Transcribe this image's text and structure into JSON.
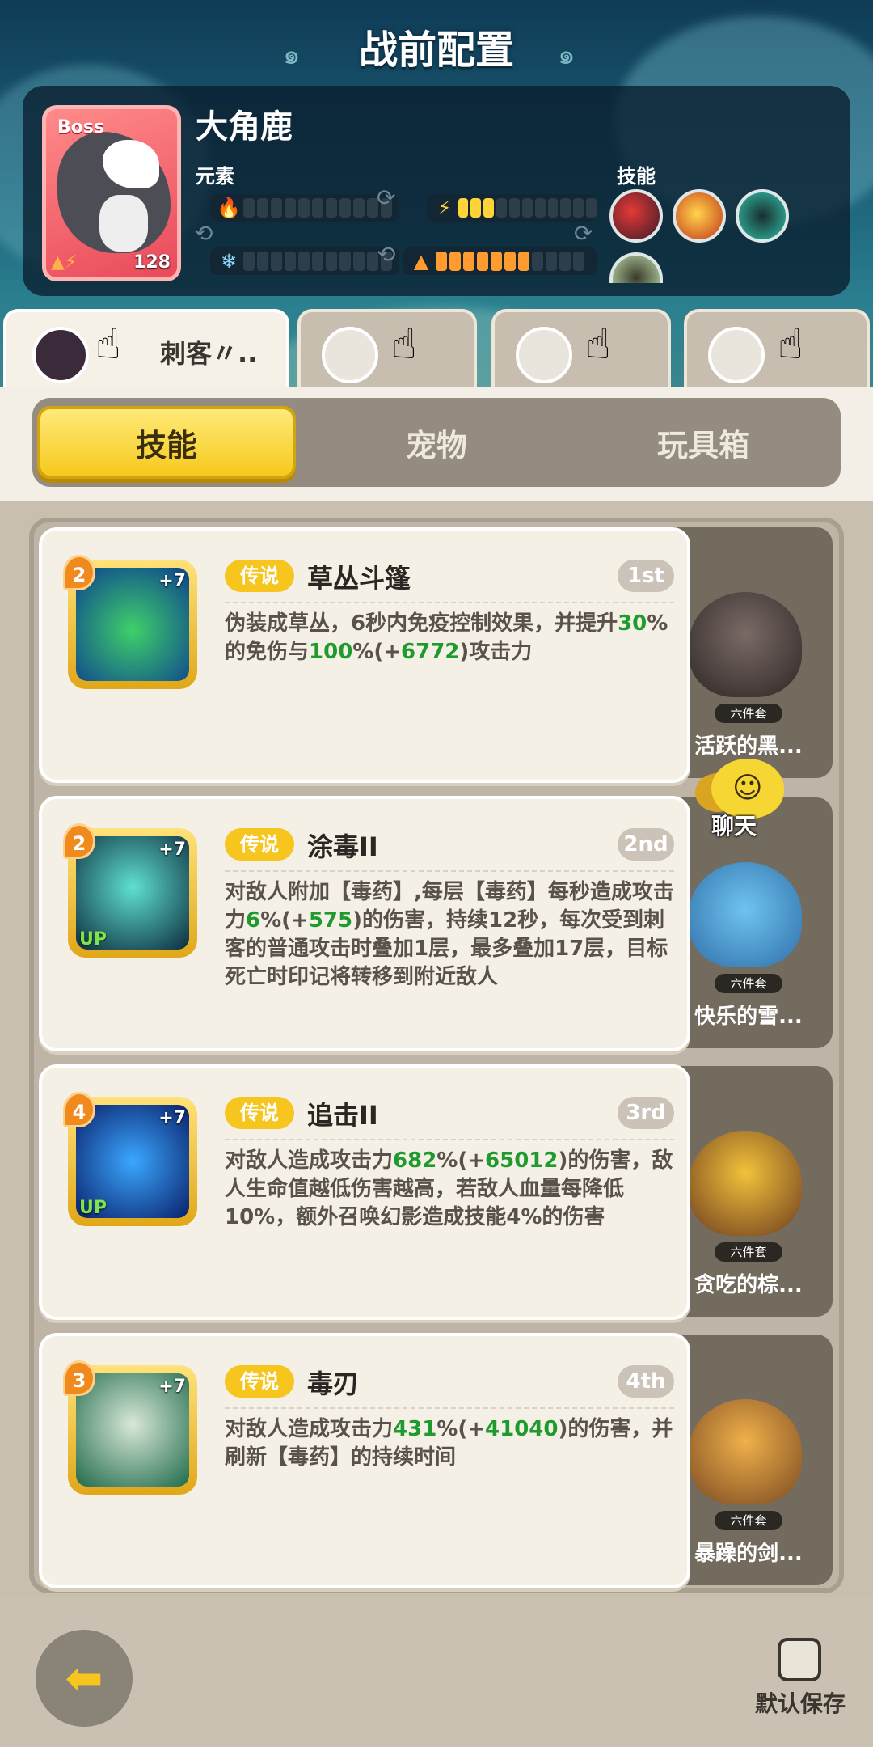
{
  "header": {
    "title": "战前配置"
  },
  "boss": {
    "tag": "Boss",
    "name": "大角鹿",
    "level": "128",
    "element_label": "元素",
    "skill_label": "技能",
    "elements": [
      {
        "icon": "fire-icon",
        "filled": 0,
        "total": 11
      },
      {
        "icon": "lightning-icon",
        "filled": 3,
        "total": 11
      },
      {
        "icon": "snowflake-icon",
        "filled": 0,
        "total": 11
      },
      {
        "icon": "earth-icon",
        "filled": 7,
        "total": 11
      }
    ],
    "colors": {
      "lightning": "#ffd43b",
      "earth": "#ff9b2f"
    }
  },
  "hero_tabs": [
    {
      "name": "刺客〃..",
      "active": true
    },
    {
      "name": "",
      "active": false
    },
    {
      "name": "",
      "active": false
    },
    {
      "name": "",
      "active": false
    }
  ],
  "segments": [
    {
      "label": "技能",
      "active": true
    },
    {
      "label": "宠物",
      "active": false
    },
    {
      "label": "玩具箱",
      "active": false
    }
  ],
  "skills": [
    {
      "level": "2",
      "plus": "+7",
      "up": "",
      "rarity": "传说",
      "name": "草丛斗篷",
      "rank": "1st",
      "desc_parts": [
        {
          "t": "伪装成草丛，6秒内免疫控制效果，并提升",
          "g": false
        },
        {
          "t": "30",
          "g": true
        },
        {
          "t": "%的免伤与",
          "g": false
        },
        {
          "t": "100",
          "g": true
        },
        {
          "t": "%(+",
          "g": false
        },
        {
          "t": "6772",
          "g": true
        },
        {
          "t": ")攻击力",
          "g": false
        }
      ],
      "pet": {
        "name": "活跃的黑...",
        "set": "六件套"
      }
    },
    {
      "level": "2",
      "plus": "+7",
      "up": "UP",
      "rarity": "传说",
      "name": "涂毒II",
      "rank": "2nd",
      "desc_parts": [
        {
          "t": "对敌人附加【毒药】,每层【毒药】每秒造成攻击力",
          "g": false
        },
        {
          "t": "6",
          "g": true
        },
        {
          "t": "%(+",
          "g": false
        },
        {
          "t": "575",
          "g": true
        },
        {
          "t": ")的伤害，持续12秒，每次受到刺客的普通攻击时叠加1层，最多叠加17层，目标死亡时印记将转移到附近敌人",
          "g": false
        }
      ],
      "pet": {
        "name": "快乐的雪...",
        "set": "六件套"
      }
    },
    {
      "level": "4",
      "plus": "+7",
      "up": "UP",
      "rarity": "传说",
      "name": "追击II",
      "rank": "3rd",
      "desc_parts": [
        {
          "t": "对敌人造成攻击力",
          "g": false
        },
        {
          "t": "682",
          "g": true
        },
        {
          "t": "%(+",
          "g": false
        },
        {
          "t": "65012",
          "g": true
        },
        {
          "t": ")的伤害，敌人生命值越低伤害越高，若敌人血量每降低10%，额外召唤幻影造成技能4%的伤害",
          "g": false
        }
      ],
      "pet": {
        "name": "贪吃的棕...",
        "set": "六件套"
      }
    },
    {
      "level": "3",
      "plus": "+7",
      "up": "",
      "rarity": "传说",
      "name": "毒刃",
      "rank": "4th",
      "desc_parts": [
        {
          "t": "对敌人造成攻击力",
          "g": false
        },
        {
          "t": "431",
          "g": true
        },
        {
          "t": "%(+",
          "g": false
        },
        {
          "t": "41040",
          "g": true
        },
        {
          "t": ")的伤害，并刷新【毒药】的持续时间",
          "g": false
        }
      ],
      "pet": {
        "name": "暴躁的剑...",
        "set": "六件套"
      }
    }
  ],
  "chat": {
    "label": "聊天"
  },
  "footer": {
    "save_label": "默认保存"
  }
}
